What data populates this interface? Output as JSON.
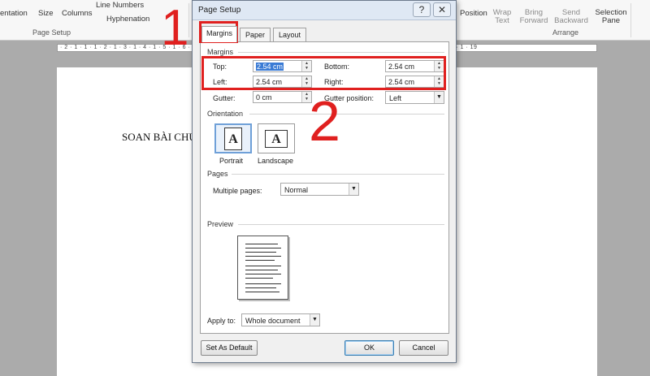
{
  "ribbon": {
    "orientation": "entation",
    "size": "Size",
    "columns": "Columns",
    "line_numbers": "Line Numbers",
    "hyphenation": "Hyphenation",
    "page_setup_group": "Page Setup",
    "position": "Position",
    "wrap_text": "Wrap Text",
    "bring_forward": "Bring Forward",
    "send_backward": "Send Backward",
    "selection_pane": "Selection Pane",
    "arrange_group": "Arrange"
  },
  "ruler": {
    "numbers": "· 2 · 1 · 1 · 1 · 2 · 1 · 3 · 1 · 4 · 1 · 5 · 1 · 6 · 1 · 7 · 1 · 8 · 1 · 9 · 1 · 10 · 1 · 11 · 1 · 12 · 1 · 13 · 1 · 14 · 1 · 15 · 1 · 16 · 1 · 17 · 1 · 18 · 1 · 19"
  },
  "document": {
    "text": "SOAN BÀI CHU"
  },
  "dialog": {
    "title": "Page Setup",
    "help": "?",
    "close": "✕",
    "tabs": [
      "Margins",
      "Paper",
      "Layout"
    ],
    "margins_section": "Margins",
    "top_label": "Top:",
    "top_value": "2.54 cm",
    "bottom_label": "Bottom:",
    "bottom_value": "2.54 cm",
    "left_label": "Left:",
    "left_value": "2.54 cm",
    "right_label": "Right:",
    "right_value": "2.54 cm",
    "gutter_label": "Gutter:",
    "gutter_value": "0 cm",
    "gutter_position_label": "Gutter position:",
    "gutter_position_value": "Left",
    "orientation_section": "Orientation",
    "portrait": "Portrait",
    "landscape": "Landscape",
    "icon_letter": "A",
    "pages_section": "Pages",
    "multiple_pages_label": "Multiple pages:",
    "multiple_pages_value": "Normal",
    "preview_section": "Preview",
    "apply_to_label": "Apply to:",
    "apply_to_value": "Whole document",
    "set_default": "Set As Default",
    "ok": "OK",
    "cancel": "Cancel"
  },
  "annotations": {
    "step1": "1",
    "step2": "2",
    "color": "#e0201f"
  }
}
